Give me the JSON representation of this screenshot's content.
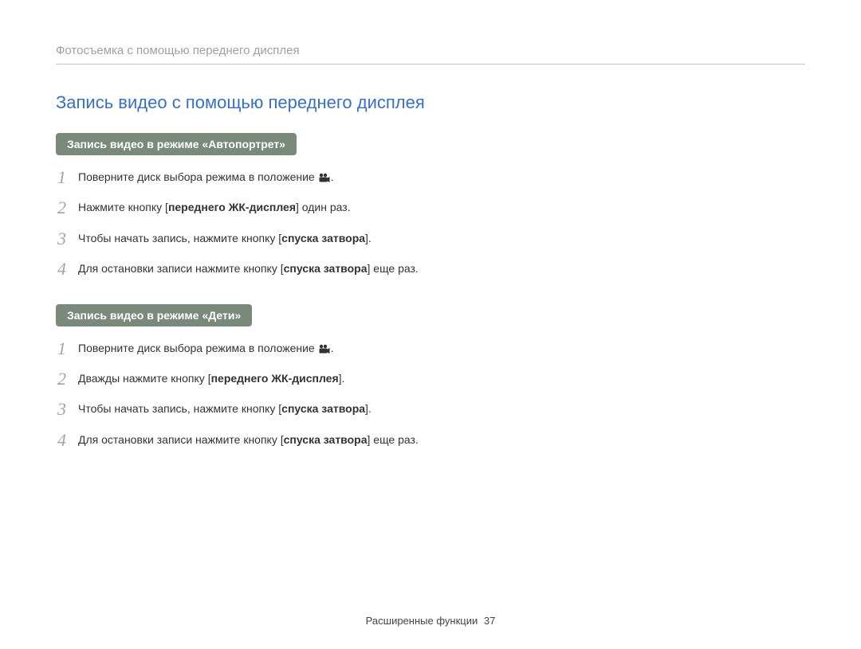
{
  "breadcrumb": "Фотосъемка с помощью переднего дисплея",
  "section_title": "Запись видео с помощью переднего дисплея",
  "block1": {
    "heading": "Запись видео в режиме «Автопортрет»",
    "steps": [
      {
        "num": "1",
        "pre": "Поверните диск выбора режима в положение ",
        "icon": "videocam",
        "post": "."
      },
      {
        "num": "2",
        "pre": "Нажмите кнопку [",
        "bold": "переднего ЖК-дисплея",
        "post": "] один раз."
      },
      {
        "num": "3",
        "pre": "Чтобы начать запись, нажмите кнопку [",
        "bold": "спуска затвора",
        "post": "]."
      },
      {
        "num": "4",
        "pre": "Для остановки записи нажмите кнопку [",
        "bold": "спуска затвора",
        "post": "] еще раз."
      }
    ]
  },
  "block2": {
    "heading": "Запись видео в режиме «Дети»",
    "steps": [
      {
        "num": "1",
        "pre": "Поверните диск выбора режима в положение ",
        "icon": "videocam",
        "post": "."
      },
      {
        "num": "2",
        "pre": "Дважды нажмите кнопку [",
        "bold": "переднего ЖК-дисплея",
        "post": "]."
      },
      {
        "num": "3",
        "pre": "Чтобы начать запись, нажмите кнопку [",
        "bold": "спуска затвора",
        "post": "]."
      },
      {
        "num": "4",
        "pre": "Для остановки записи нажмите кнопку [",
        "bold": "спуска затвора",
        "post": "] еще раз."
      }
    ]
  },
  "footer": {
    "label": "Расширенные функции",
    "page": "37"
  }
}
